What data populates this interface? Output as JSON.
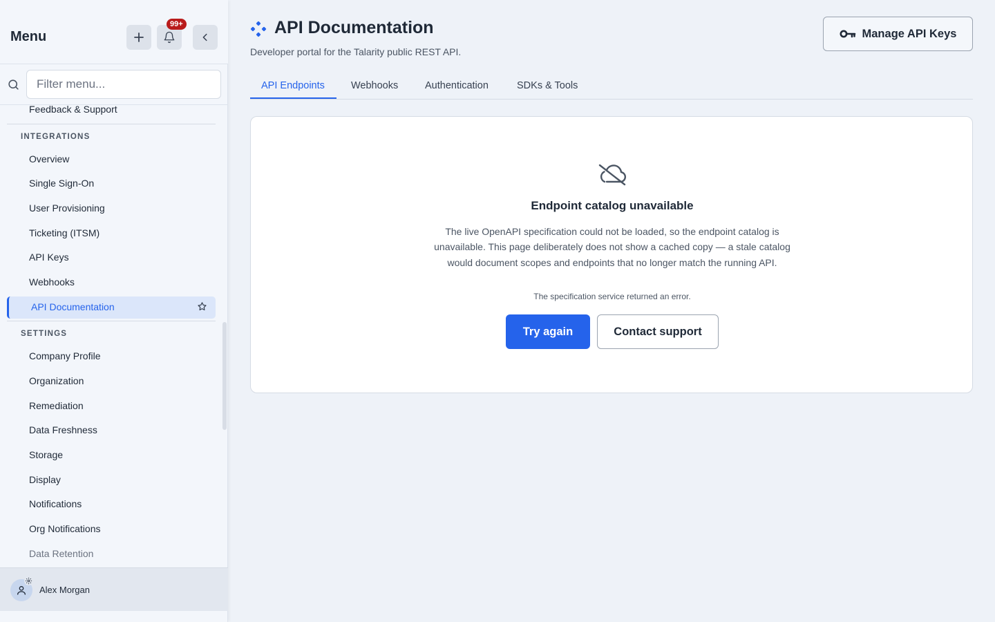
{
  "sidebar": {
    "title": "Menu",
    "notification_count": "99+",
    "search_placeholder": "Filter menu...",
    "top_item": "Feedback & Support",
    "sections": [
      {
        "label": "INTEGRATIONS",
        "items": [
          "Overview",
          "Single Sign-On",
          "User Provisioning",
          "Ticketing (ITSM)",
          "API Keys",
          "Webhooks",
          "API Documentation"
        ]
      },
      {
        "label": "SETTINGS",
        "items": [
          "Company Profile",
          "Organization",
          "Remediation",
          "Data Freshness",
          "Storage",
          "Display",
          "Notifications",
          "Org Notifications",
          "Data Retention"
        ]
      }
    ],
    "active_item": "API Documentation",
    "user": {
      "name": "Alex Morgan"
    }
  },
  "header": {
    "title": "API Documentation",
    "subtitle": "Developer portal for the Talarity public REST API.",
    "manage_button": "Manage API Keys"
  },
  "tabs": [
    {
      "label": "API Endpoints",
      "active": true
    },
    {
      "label": "Webhooks",
      "active": false
    },
    {
      "label": "Authentication",
      "active": false
    },
    {
      "label": "SDKs & Tools",
      "active": false
    }
  ],
  "error_card": {
    "icon": "cloud-off-icon",
    "title": "Endpoint catalog unavailable",
    "body": "The live OpenAPI specification could not be loaded, so the endpoint catalog is unavailable. This page deliberately does not show a cached copy — a stale catalog would document scopes and endpoints that no longer match the running API.",
    "note": "The specification service returned an error.",
    "primary_button": "Try again",
    "secondary_button": "Contact support"
  },
  "colors": {
    "accent": "#2563eb",
    "badge": "#b91c1c",
    "active_nav_bg": "#dbe6fa",
    "page_bg": "#eef2f8"
  }
}
